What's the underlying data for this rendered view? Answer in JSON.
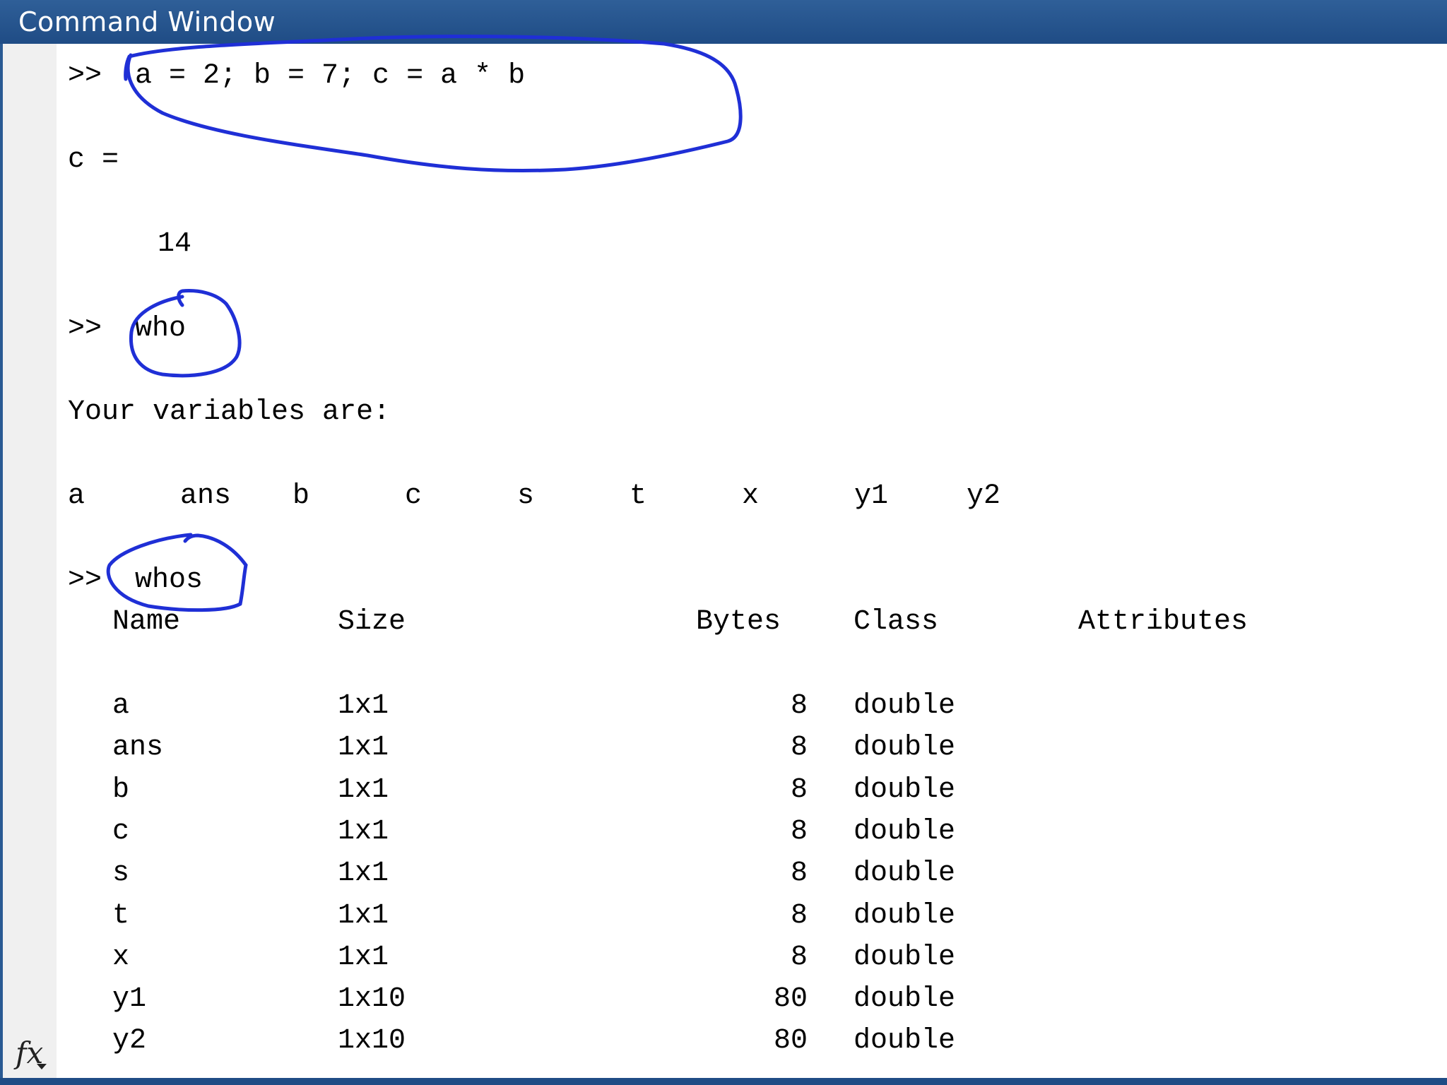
{
  "window": {
    "title": "Command Window"
  },
  "session": {
    "prompt": ">>",
    "cmd1": "a = 2; b = 7; c = a * b",
    "result_label": "c =",
    "result_value": "14",
    "cmd2": "who",
    "who_header": "Your variables are:",
    "who_vars": [
      "a",
      "ans",
      "b",
      "c",
      "s",
      "t",
      "x",
      "y1",
      "y2"
    ],
    "cmd3": "whos"
  },
  "whos_table": {
    "headers": {
      "name": "Name",
      "size": "Size",
      "bytes": "Bytes",
      "class": "Class",
      "attributes": "Attributes"
    },
    "rows": [
      {
        "name": "a",
        "size": "1x1",
        "bytes": "8",
        "class": "double"
      },
      {
        "name": "ans",
        "size": "1x1",
        "bytes": "8",
        "class": "double"
      },
      {
        "name": "b",
        "size": "1x1",
        "bytes": "8",
        "class": "double"
      },
      {
        "name": "c",
        "size": "1x1",
        "bytes": "8",
        "class": "double"
      },
      {
        "name": "s",
        "size": "1x1",
        "bytes": "8",
        "class": "double"
      },
      {
        "name": "t",
        "size": "1x1",
        "bytes": "8",
        "class": "double"
      },
      {
        "name": "x",
        "size": "1x1",
        "bytes": "8",
        "class": "double"
      },
      {
        "name": "y1",
        "size": "1x10",
        "bytes": "80",
        "class": "double"
      },
      {
        "name": "y2",
        "size": "1x10",
        "bytes": "80",
        "class": "double"
      }
    ]
  },
  "footer": {
    "icon": "fx-icon",
    "label": "fx"
  },
  "colors": {
    "titlebar": "#1f4c85",
    "annotation": "#1f2fd6",
    "gutter": "#f0f0f0"
  }
}
